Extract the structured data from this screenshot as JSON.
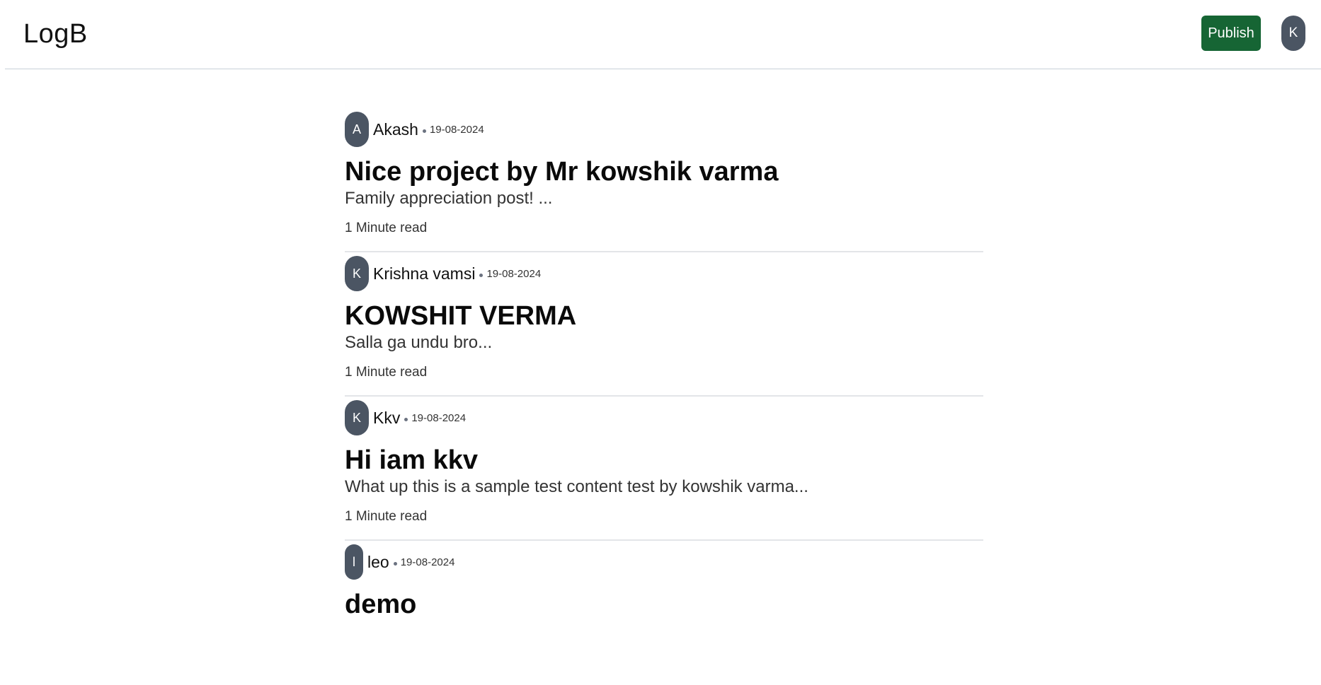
{
  "app": {
    "logo": "LogB",
    "publish_label": "Publish",
    "user_initial": "K"
  },
  "posts": [
    {
      "initial": "A",
      "author": "Akash",
      "date": "19-08-2024",
      "title": "Nice project by Mr kowshik varma",
      "excerpt": "Family appreciation post! ...",
      "read_time": "1 Minute read"
    },
    {
      "initial": "K",
      "author": "Krishna vamsi",
      "date": "19-08-2024",
      "title": "KOWSHIT VERMA",
      "excerpt": "Salla ga undu bro...",
      "read_time": "1 Minute read"
    },
    {
      "initial": "K",
      "author": "Kkv",
      "date": "19-08-2024",
      "title": "Hi iam kkv",
      "excerpt": "What up this is a sample test content test by kowshik varma...",
      "read_time": "1 Minute read"
    },
    {
      "initial": "l",
      "author": "leo",
      "date": "19-08-2024",
      "title": "demo"
    }
  ],
  "colors": {
    "publish_bg": "#166534",
    "avatar_bg": "#4b5563",
    "divider": "#e3e5e8"
  }
}
